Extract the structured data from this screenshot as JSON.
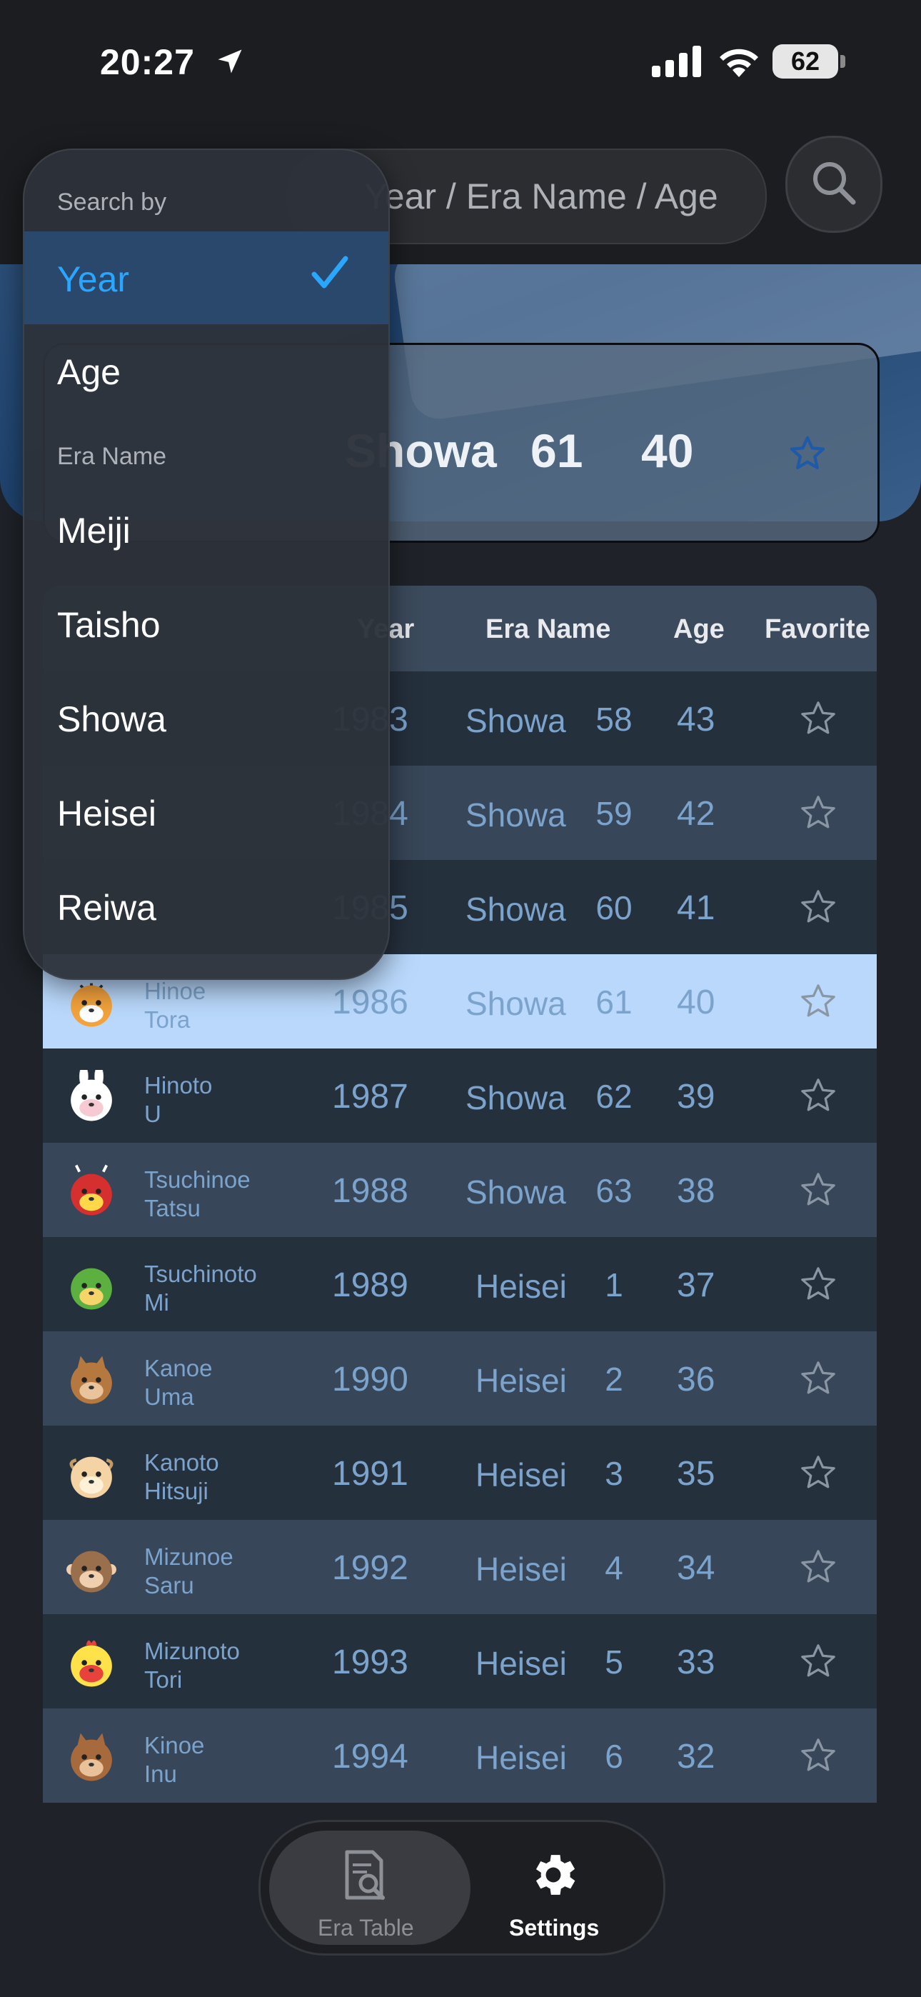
{
  "status_bar": {
    "time": "20:27",
    "battery": "62"
  },
  "search": {
    "placeholder": "Year / Era Name / Age"
  },
  "highlight_card": {
    "era": "Showa",
    "era_year": "61",
    "age": "40"
  },
  "table": {
    "headers": {
      "year": "Year",
      "era": "Era Name",
      "age": "Age",
      "favorite": "Favorite"
    },
    "rows": [
      {
        "zodiac": "",
        "year": "1983",
        "era": "Showa",
        "era_year": "58",
        "age": "43",
        "animal": "hidden"
      },
      {
        "zodiac": "",
        "year": "1984",
        "era": "Showa",
        "era_year": "59",
        "age": "42",
        "animal": "hidden"
      },
      {
        "zodiac": "",
        "year": "1985",
        "era": "Showa",
        "era_year": "60",
        "age": "41",
        "animal": "hidden"
      },
      {
        "zodiac": "Hinoe\nTora",
        "year": "1986",
        "era": "Showa",
        "era_year": "61",
        "age": "40",
        "animal": "tiger"
      },
      {
        "zodiac": "Hinoto\nU",
        "year": "1987",
        "era": "Showa",
        "era_year": "62",
        "age": "39",
        "animal": "rabbit"
      },
      {
        "zodiac": "Tsuchinoe\nTatsu",
        "year": "1988",
        "era": "Showa",
        "era_year": "63",
        "age": "38",
        "animal": "dragon"
      },
      {
        "zodiac": "Tsuchinoto\nMi",
        "year": "1989",
        "era": "Heisei",
        "era_year": "1",
        "age": "37",
        "animal": "snake"
      },
      {
        "zodiac": "Kanoe\nUma",
        "year": "1990",
        "era": "Heisei",
        "era_year": "2",
        "age": "36",
        "animal": "horse"
      },
      {
        "zodiac": "Kanoto\nHitsuji",
        "year": "1991",
        "era": "Heisei",
        "era_year": "3",
        "age": "35",
        "animal": "sheep"
      },
      {
        "zodiac": "Mizunoe\nSaru",
        "year": "1992",
        "era": "Heisei",
        "era_year": "4",
        "age": "34",
        "animal": "monkey"
      },
      {
        "zodiac": "Mizunoto\nTori",
        "year": "1993",
        "era": "Heisei",
        "era_year": "5",
        "age": "33",
        "animal": "rooster"
      },
      {
        "zodiac": "Kinoe\nInu",
        "year": "1994",
        "era": "Heisei",
        "era_year": "6",
        "age": "32",
        "animal": "dog"
      }
    ]
  },
  "dropdown": {
    "heading": "Search by",
    "items_top": [
      "Year",
      "Age"
    ],
    "selected": "Year",
    "era_heading": "Era Name",
    "era_items": [
      "Meiji",
      "Taisho",
      "Showa",
      "Heisei",
      "Reiwa"
    ]
  },
  "tabs": [
    {
      "label": "Era Table",
      "icon": "document-search-icon"
    },
    {
      "label": "Settings",
      "icon": "gear-icon"
    }
  ],
  "colors": {
    "accent": "#2aa6ff",
    "selected_row": "#b9d8fb",
    "cell_text": "#7ba3cc"
  }
}
